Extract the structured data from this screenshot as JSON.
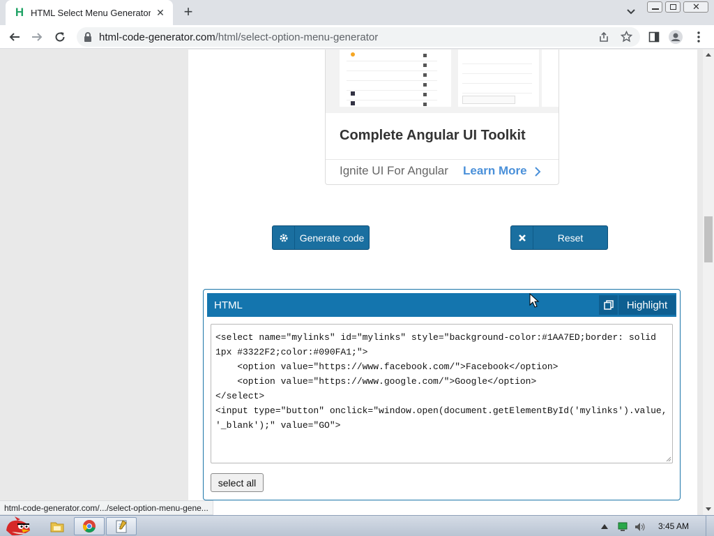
{
  "browser": {
    "tab": {
      "favicon_letter": "H",
      "title": "HTML Select Menu Generator"
    },
    "address": {
      "domain": "html-code-generator.com",
      "path": "/html/select-option-menu-generator"
    },
    "status_url": "html-code-generator.com/.../select-option-menu-gene..."
  },
  "ad": {
    "title": "Complete Angular UI Toolkit",
    "brand": "Ignite UI For Angular",
    "cta": "Learn More"
  },
  "actions": {
    "generate_label": "Generate code",
    "reset_label": "Reset"
  },
  "output_panel": {
    "title": "HTML",
    "highlight_label": "Highlight",
    "code_lines": [
      "<select name=\"mylinks\" id=\"mylinks\" style=\"background-color:#1AA7ED;border: solid",
      "1px #3322F2;color:#090FA1;\">",
      "    <option value=\"https://www.facebook.com/\">Facebook</option>",
      "    <option value=\"https://www.google.com/\">Google</option>",
      "</select>",
      "<input type=\"button\" onclick=\"window.open(document.getElementById('mylinks').value,",
      "'_blank');\" value=\"GO\">"
    ],
    "select_all_label": "select all"
  },
  "taskbar": {
    "clock": "3:45 AM"
  },
  "colors": {
    "brand_blue": "#1475ae",
    "button_blue": "#1a6fa0",
    "link_blue": "#4a90d9"
  }
}
